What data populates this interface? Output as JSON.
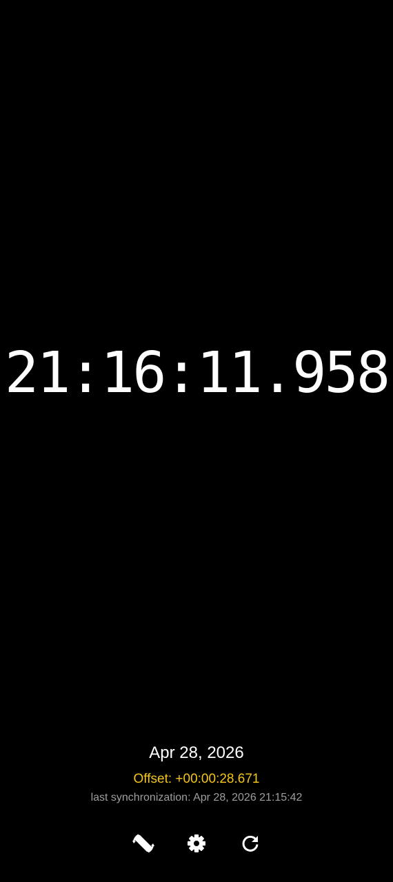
{
  "clock": {
    "time": "21:16:11.958"
  },
  "status": {
    "date": "Apr 28, 2026",
    "offset": "Offset: +00:00:28.671",
    "last_sync": "last synchronization: Apr 28, 2026 21:15:42"
  },
  "toolbar": {
    "buttons": [
      {
        "icon": "screen-rotation-icon"
      },
      {
        "icon": "gear-icon"
      },
      {
        "icon": "refresh-icon"
      }
    ]
  },
  "colors": {
    "background": "#000000",
    "clock_text": "#ffffff",
    "offset_text": "#f5c518",
    "last_sync_text": "#9e9e9e",
    "icons": "#ffffff"
  }
}
